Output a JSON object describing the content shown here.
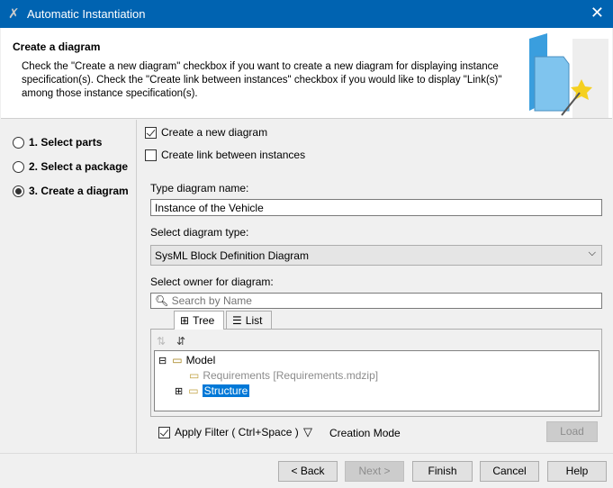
{
  "window": {
    "title": "Automatic Instantiation",
    "close": "✕"
  },
  "header": {
    "title": "Create a diagram",
    "description": "Check the \"Create a new diagram\" checkbox if you want to create a new diagram for displaying instance specification(s). Check the \"Create link between instances\" checkbox if you would like to display \"Link(s)\" among those instance specification(s)."
  },
  "steps": [
    {
      "label": "1. Select parts",
      "selected": false
    },
    {
      "label": "2. Select a package",
      "selected": false
    },
    {
      "label": "3. Create a diagram",
      "selected": true
    }
  ],
  "options": {
    "create_diagram": {
      "label": "Create a new diagram",
      "checked": true
    },
    "create_link": {
      "label": "Create link between instances",
      "checked": false
    }
  },
  "name_label": "Type diagram name:",
  "name_value": "Instance of the Vehicle",
  "type_label": "Select diagram type:",
  "type_value": "SysML Block Definition Diagram",
  "owner_label": "Select owner for diagram:",
  "search_placeholder": "Search by Name",
  "tabs": [
    {
      "label": "Tree",
      "active": true
    },
    {
      "label": "List",
      "active": false
    }
  ],
  "tree": {
    "root": "Model",
    "children": [
      {
        "name": "Requirements",
        "suffix": "[Requirements.mdzip]"
      },
      {
        "name": "Structure",
        "selected": true
      }
    ]
  },
  "filter": {
    "label": "Apply Filter ( Ctrl+Space )",
    "checked": true
  },
  "creation_mode": "Creation Mode",
  "load": "Load",
  "buttons": {
    "back": "< Back",
    "next": "Next >",
    "finish": "Finish",
    "cancel": "Cancel",
    "help": "Help"
  }
}
